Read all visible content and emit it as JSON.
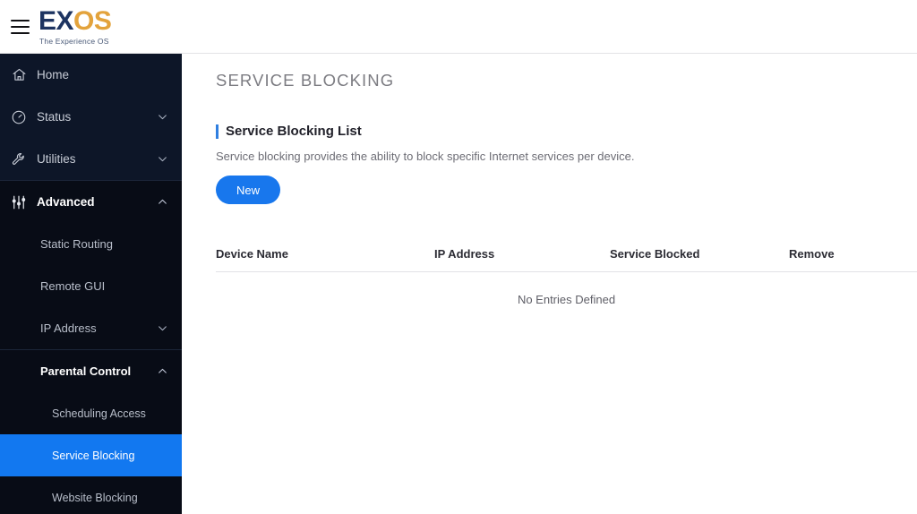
{
  "topbar": {
    "menu_icon": "hamburger-menu-icon",
    "logo": {
      "part1": "EX",
      "part2": "OS",
      "tagline": "The Experience OS",
      "color_part1": "#1d3461",
      "color_part2": "#e3a33c"
    }
  },
  "sidebar": {
    "background": "#0d1628",
    "active_color": "#1278f0",
    "items": [
      {
        "label": "Home",
        "icon": "home-icon",
        "chevron": "none",
        "level": 0,
        "active": false,
        "bold": false
      },
      {
        "label": "Status",
        "icon": "gauge-icon",
        "chevron": "down",
        "level": 0,
        "active": false,
        "bold": false
      },
      {
        "label": "Utilities",
        "icon": "wrench-icon",
        "chevron": "down",
        "level": 0,
        "active": false,
        "bold": false
      },
      {
        "label": "Advanced",
        "icon": "sliders-icon",
        "chevron": "up",
        "level": 0,
        "active": false,
        "bold": true
      },
      {
        "label": "Static Routing",
        "icon": "none",
        "chevron": "none",
        "level": 1,
        "active": false,
        "bold": false
      },
      {
        "label": "Remote GUI",
        "icon": "none",
        "chevron": "none",
        "level": 1,
        "active": false,
        "bold": false
      },
      {
        "label": "IP Address",
        "icon": "none",
        "chevron": "down",
        "level": 1,
        "active": false,
        "bold": false
      },
      {
        "label": "Parental Control",
        "icon": "none",
        "chevron": "up",
        "level": 1,
        "active": false,
        "bold": true
      },
      {
        "label": "Scheduling Access",
        "icon": "none",
        "chevron": "none",
        "level": 2,
        "active": false,
        "bold": false
      },
      {
        "label": "Service Blocking",
        "icon": "none",
        "chevron": "none",
        "level": 2,
        "active": true,
        "bold": false
      },
      {
        "label": "Website Blocking",
        "icon": "none",
        "chevron": "none",
        "level": 2,
        "active": false,
        "bold": false
      }
    ]
  },
  "main": {
    "page_title": "SERVICE BLOCKING",
    "section_title": "Service Blocking List",
    "section_desc": "Service blocking provides the ability to block specific Internet services per device.",
    "new_button": "New",
    "accent_color": "#2f7fe0",
    "button_color": "#1877ed",
    "table": {
      "columns": [
        "Device Name",
        "IP Address",
        "Service Blocked",
        "Remove"
      ],
      "rows": [],
      "empty_message": "No Entries Defined"
    }
  }
}
